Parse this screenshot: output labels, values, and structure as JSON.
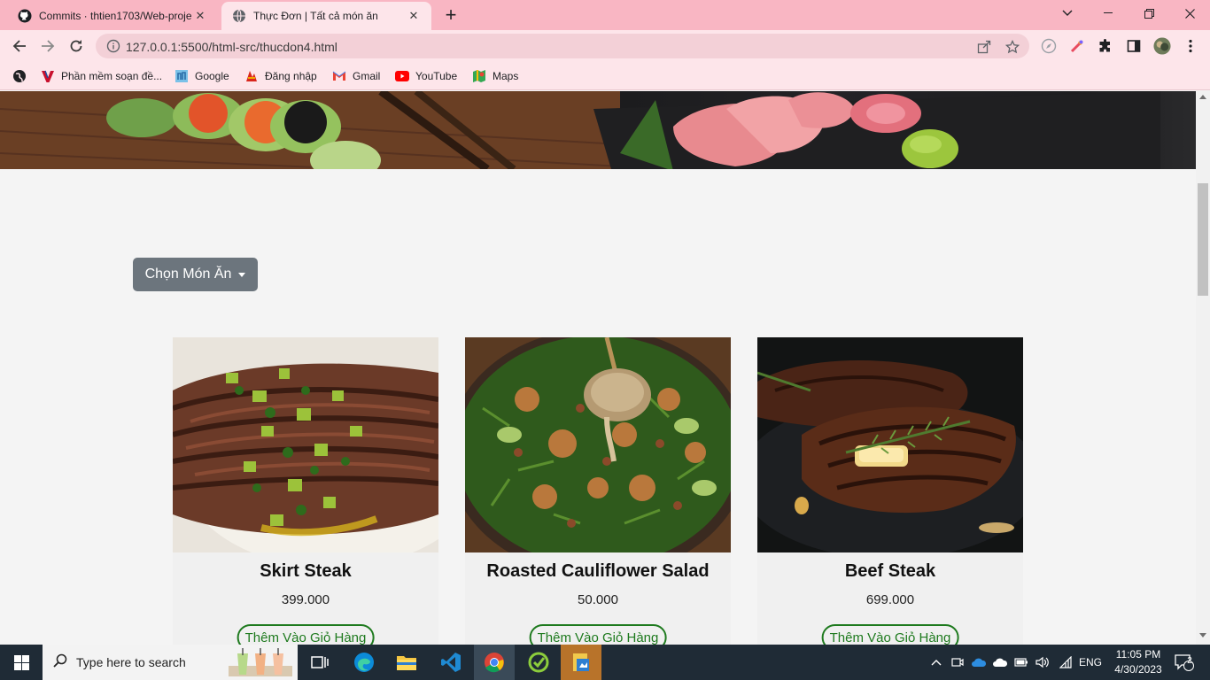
{
  "browser": {
    "tabs": [
      {
        "title": "Commits · thtien1703/Web-proje",
        "icon": "github-icon",
        "active": false
      },
      {
        "title": "Thực Đơn | Tất cả món ăn",
        "icon": "globe-icon",
        "active": true
      }
    ],
    "new_tab": "+",
    "url": "127.0.0.1:5500/html-src/thucdon4.html",
    "bookmarks": [
      {
        "label": "Phần mềm soạn đề..."
      },
      {
        "label": "Google"
      },
      {
        "label": "Đăng nhập"
      },
      {
        "label": "Gmail"
      },
      {
        "label": "YouTube"
      },
      {
        "label": "Maps"
      }
    ]
  },
  "page": {
    "dropdown_label": "Chọn Món Ăn",
    "products": [
      {
        "name": "Skirt Steak",
        "price": "399.000",
        "button": "Thêm Vào Giỏ Hàng"
      },
      {
        "name": "Roasted Cauliflower Salad",
        "price": "50.000",
        "button": "Thêm Vào Giỏ Hàng"
      },
      {
        "name": "Beef Steak",
        "price": "699.000",
        "button": "Thêm Vào Giỏ Hàng"
      }
    ]
  },
  "taskbar": {
    "search_placeholder": "Type here to search",
    "language": "ENG",
    "time": "11:05 PM",
    "date": "4/30/2023",
    "notifications": "2"
  }
}
